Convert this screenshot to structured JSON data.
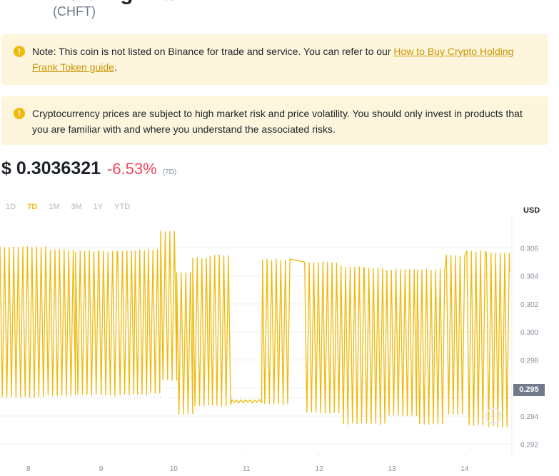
{
  "header": {
    "coin_symbol": "(CHFT)"
  },
  "notices": {
    "listing": {
      "text": "Note: This coin is not listed on Binance for trade and service. You can refer to our ",
      "link": "How to Buy Crypto Holding Frank Token guide",
      "suffix": "."
    },
    "risk": {
      "text": "Cryptocurrency prices are subject to high market risk and price volatility. You should only invest in products that you are familiar with and where you understand the associated risks."
    },
    "icon": "warning-icon"
  },
  "price": {
    "value": "$ 0.3036321",
    "change": "-6.53%",
    "period": "(7D)"
  },
  "tabs": [
    {
      "label": "1D",
      "active": false
    },
    {
      "label": "7D",
      "active": true
    },
    {
      "label": "1M",
      "active": false
    },
    {
      "label": "3M",
      "active": false
    },
    {
      "label": "1Y",
      "active": false
    },
    {
      "label": "YTD",
      "active": false
    }
  ],
  "colors": {
    "accent": "#f0b90b",
    "negative": "#f6465d",
    "warning_bg": "#fdf6dd"
  },
  "chart_data": {
    "type": "line",
    "currency": "USD",
    "current_value_tag": "0.295",
    "y_ticks": [
      "0.306",
      "0.304",
      "0.302",
      "0.300",
      "0.298",
      "0.296",
      "0.294",
      "0.292"
    ],
    "ylim": [
      0.2913,
      0.3081
    ],
    "x_tick_labels": [
      "8",
      "9",
      "10",
      "11",
      "12",
      "13",
      "14"
    ],
    "x_days": [
      8,
      9,
      10,
      11,
      12,
      13,
      14
    ],
    "xlim": [
      7.61,
      14.65
    ],
    "grid": true,
    "low_baseline": 0.2953,
    "series": [
      {
        "segments": [
          {
            "from": 7.61,
            "to": 8.24,
            "high": 0.3061,
            "low": 0.2953
          },
          {
            "from": 8.24,
            "to": 8.65,
            "high": 0.3059,
            "low": 0.2954
          },
          {
            "from": 8.65,
            "to": 8.97,
            "high": 0.3058,
            "low": 0.2955
          },
          {
            "from": 8.97,
            "to": 9.23,
            "high": 0.3058,
            "low": 0.2954
          },
          {
            "from": 9.23,
            "to": 9.47,
            "high": 0.3058,
            "low": 0.2955
          },
          {
            "from": 9.47,
            "to": 9.65,
            "high": 0.3059,
            "low": 0.2955
          },
          {
            "from": 9.65,
            "to": 9.82,
            "high": 0.3059,
            "low": 0.2956
          },
          {
            "from": 9.82,
            "to": 10.04,
            "high": 0.3072,
            "low": 0.2965
          },
          {
            "from": 10.04,
            "to": 10.26,
            "high": 0.3043,
            "low": 0.2941
          },
          {
            "from": 10.26,
            "to": 10.5,
            "high": 0.3053,
            "low": 0.2947
          },
          {
            "from": 10.5,
            "to": 10.8,
            "high": 0.3055,
            "low": 0.2947
          },
          {
            "from": 10.8,
            "to": 11.22,
            "high": 0.2952,
            "low": 0.2949
          },
          {
            "from": 11.22,
            "to": 11.62,
            "high": 0.3052,
            "low": 0.2948
          },
          {
            "from": 11.8,
            "to": 12.3,
            "high": 0.305,
            "low": 0.2942
          },
          {
            "from": 12.3,
            "to": 12.62,
            "high": 0.3047,
            "low": 0.2934
          },
          {
            "from": 12.62,
            "to": 12.93,
            "high": 0.3046,
            "low": 0.2934
          },
          {
            "from": 12.93,
            "to": 13.35,
            "high": 0.3045,
            "low": 0.294
          },
          {
            "from": 13.35,
            "to": 13.75,
            "high": 0.3045,
            "low": 0.2934
          },
          {
            "from": 13.75,
            "to": 14.03,
            "high": 0.3055,
            "low": 0.2941
          },
          {
            "from": 14.03,
            "to": 14.3,
            "high": 0.3058,
            "low": 0.2933
          },
          {
            "from": 14.3,
            "to": 14.62,
            "high": 0.3057,
            "low": 0.2932
          }
        ],
        "last": 0.3043
      }
    ]
  }
}
